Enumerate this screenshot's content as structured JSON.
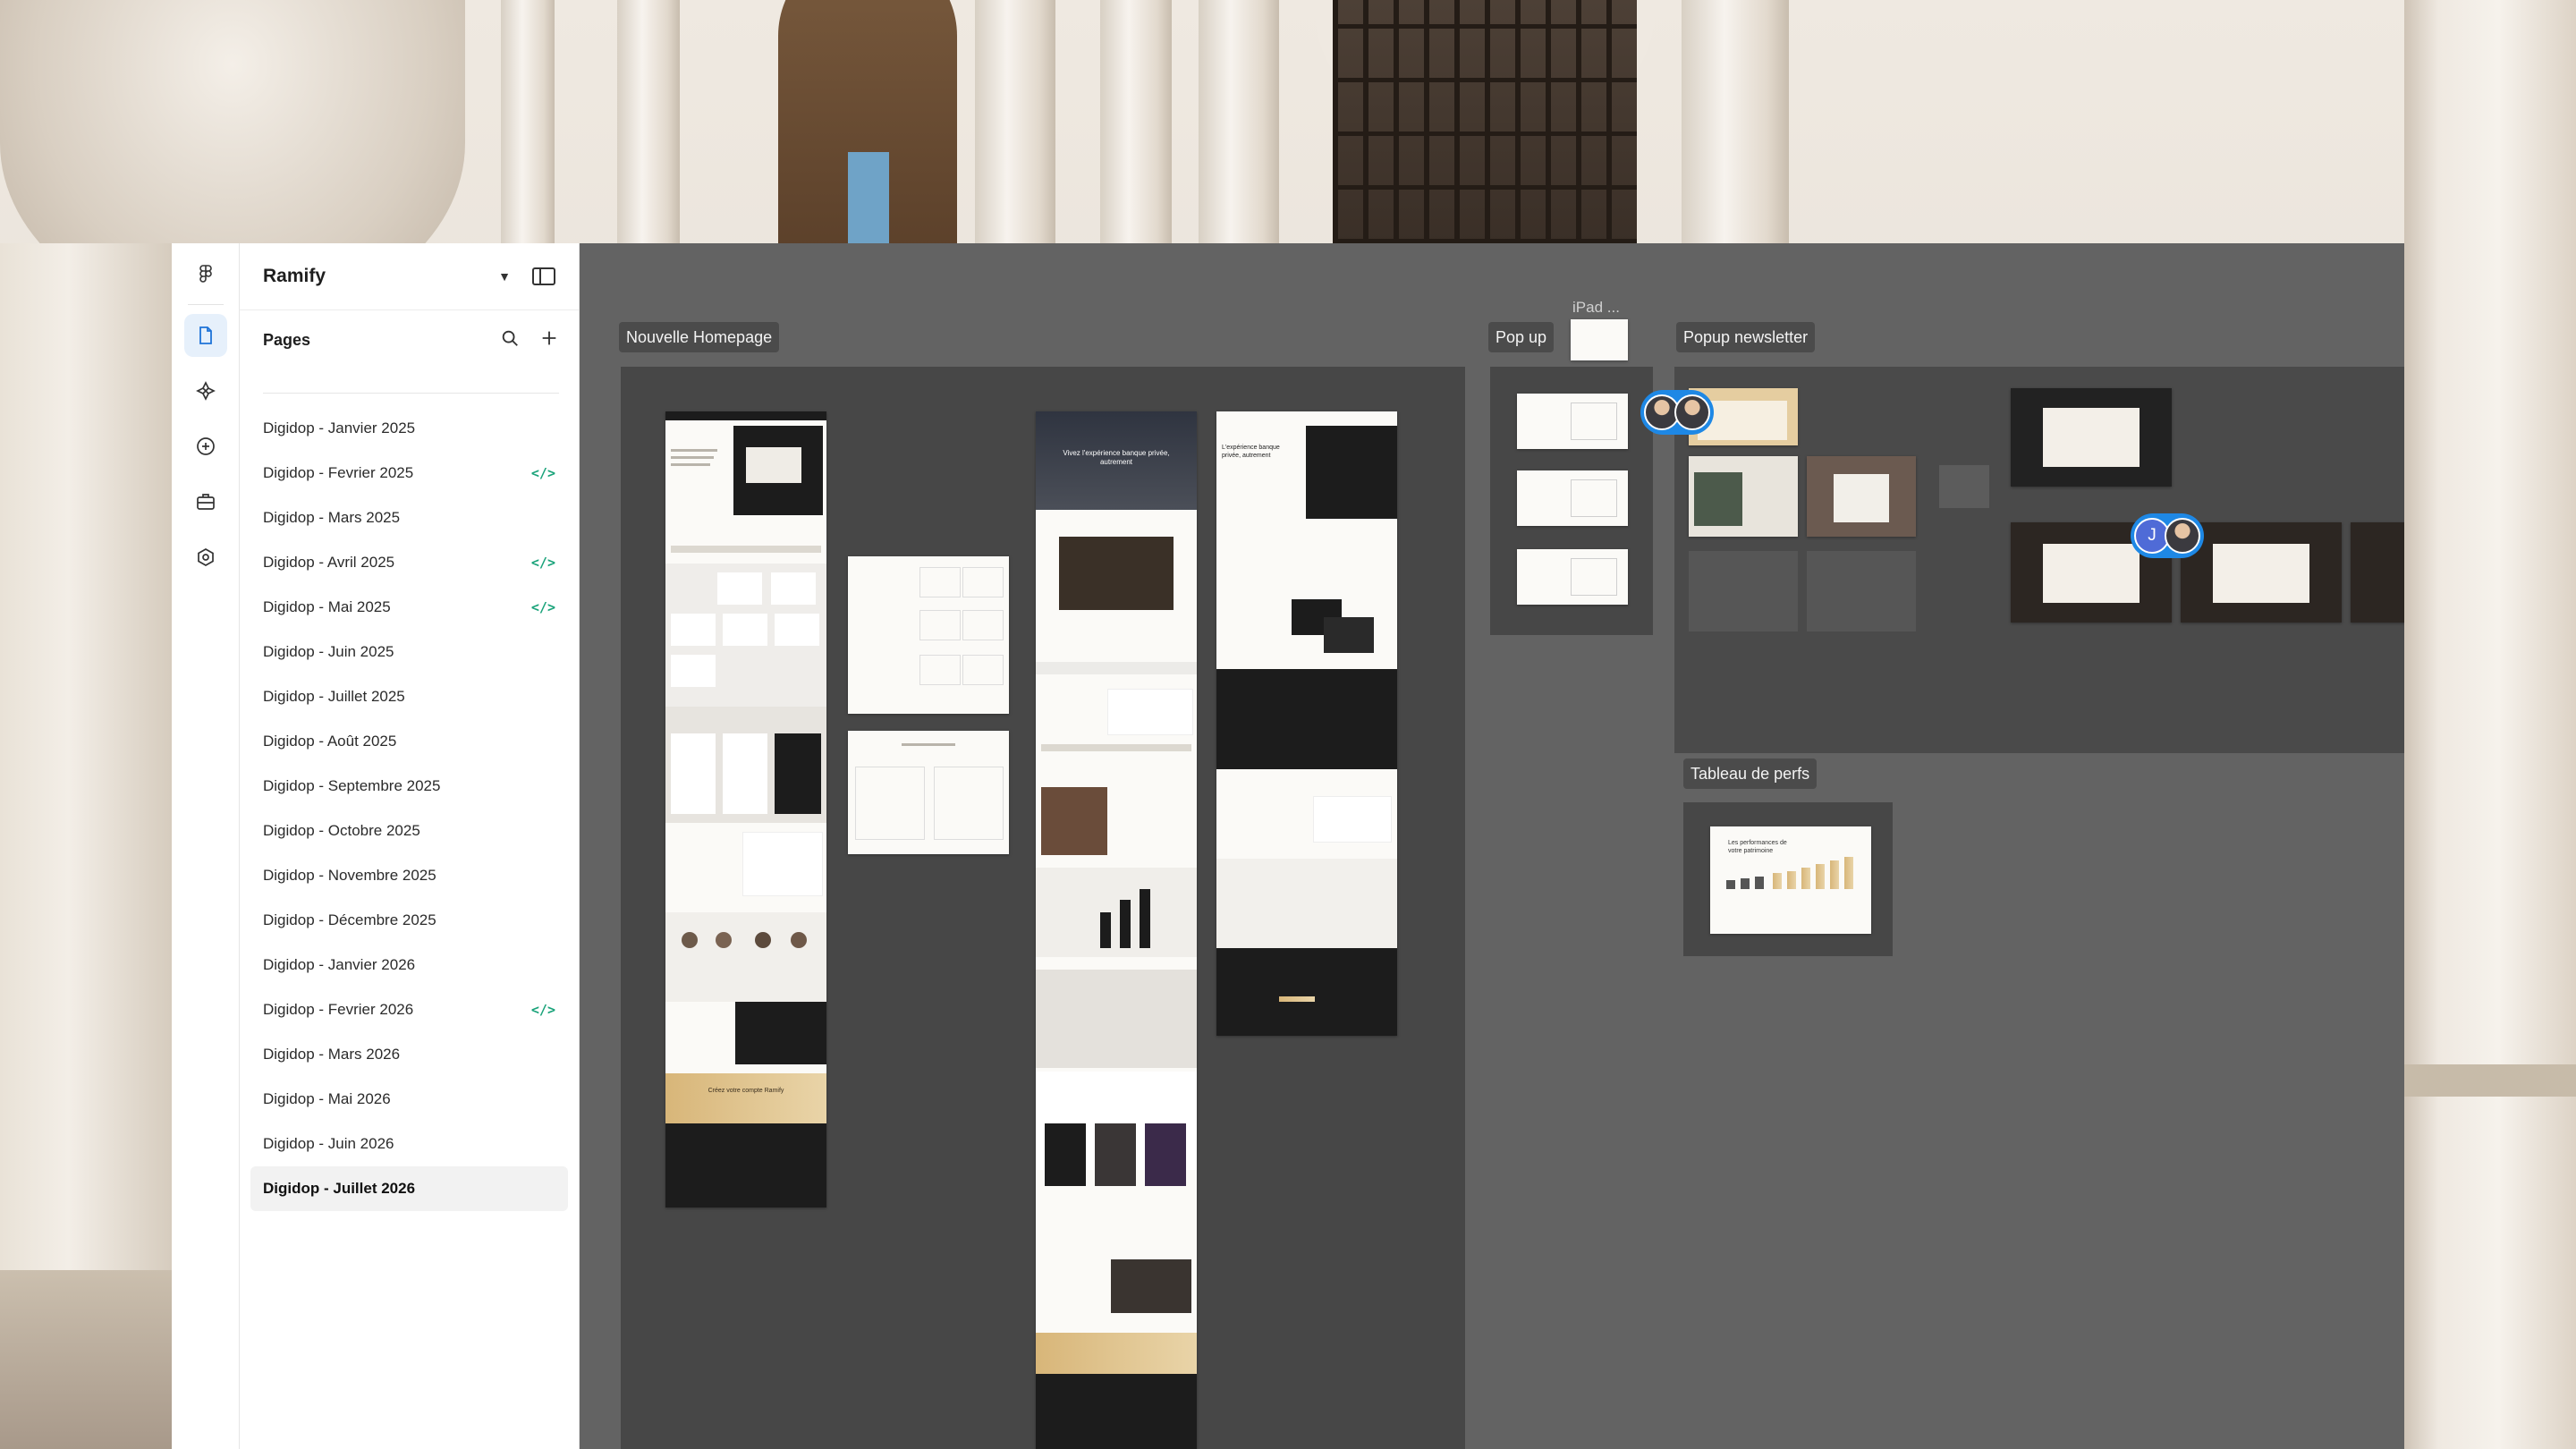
{
  "project": {
    "name": "Ramify"
  },
  "pages": {
    "label": "Pages",
    "items": [
      {
        "label": "Digidop - Janvier 2025",
        "dev_mode": false,
        "selected": false
      },
      {
        "label": "Digidop - Fevrier  2025",
        "dev_mode": true,
        "selected": false
      },
      {
        "label": "Digidop - Mars  2025",
        "dev_mode": false,
        "selected": false
      },
      {
        "label": "Digidop - Avril 2025",
        "dev_mode": true,
        "selected": false
      },
      {
        "label": "Digidop - Mai 2025",
        "dev_mode": true,
        "selected": false
      },
      {
        "label": "Digidop - Juin 2025",
        "dev_mode": false,
        "selected": false
      },
      {
        "label": "Digidop - Juillet 2025",
        "dev_mode": false,
        "selected": false
      },
      {
        "label": "Digidop - Août 2025",
        "dev_mode": false,
        "selected": false
      },
      {
        "label": "Digidop - Septembre 2025",
        "dev_mode": false,
        "selected": false
      },
      {
        "label": "Digidop - Octobre 2025",
        "dev_mode": false,
        "selected": false
      },
      {
        "label": "Digidop - Novembre 2025",
        "dev_mode": false,
        "selected": false
      },
      {
        "label": "Digidop - Décembre 2025",
        "dev_mode": false,
        "selected": false
      },
      {
        "label": "Digidop - Janvier 2026",
        "dev_mode": false,
        "selected": false
      },
      {
        "label": "Digidop - Fevrier 2026",
        "dev_mode": true,
        "selected": false
      },
      {
        "label": "Digidop - Mars 2026",
        "dev_mode": false,
        "selected": false
      },
      {
        "label": "Digidop - Mai 2026",
        "dev_mode": false,
        "selected": false
      },
      {
        "label": "Digidop - Juin 2026",
        "dev_mode": false,
        "selected": false
      },
      {
        "label": "Digidop - Juillet 2026",
        "dev_mode": false,
        "selected": true
      }
    ],
    "dev_mode_glyph": "</>"
  },
  "rail": {
    "icons": [
      "figma-logo-icon",
      "file-icon",
      "assets-icon",
      "plus-circle-icon",
      "briefcase-icon",
      "plugin-icon"
    ],
    "active": "file-icon"
  },
  "canvas": {
    "frames": {
      "homepage": "Nouvelle Homepage",
      "popup": "Pop up",
      "ipad": "iPad ...",
      "newsletter": "Popup newsletter",
      "perfs": "Tableau de perfs"
    },
    "mock_texts": {
      "hero_dark": "Vivez l'expérience banque privée, autrement",
      "hero_light": "L'expérience banque privée, autrement",
      "cta_gold": "Créez votre compte Ramify",
      "perfs_title": "Les performances de votre patrimoine"
    },
    "collaborators": {
      "top": [
        "avatar-a",
        "avatar-b"
      ],
      "mid_initial": "J"
    }
  },
  "colors": {
    "canvas": "#636363",
    "section": "#474747",
    "accent_gold": "#d8b679",
    "dev_mode": "#1aa37a",
    "selection_blue": "#1e88e5"
  }
}
